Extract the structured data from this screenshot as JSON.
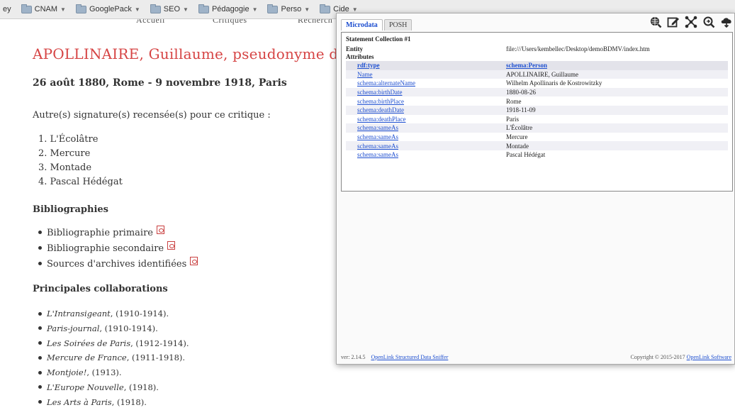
{
  "bookmarks": [
    {
      "label": "ey",
      "folder": false
    },
    {
      "label": "CNAM",
      "folder": true
    },
    {
      "label": "GooglePack",
      "folder": true
    },
    {
      "label": "SEO",
      "folder": true
    },
    {
      "label": "Pédagogie",
      "folder": true
    },
    {
      "label": "Perso",
      "folder": true
    },
    {
      "label": "Cide",
      "folder": true
    }
  ],
  "site_nav": {
    "home": "Accueil",
    "critics": "Critiques",
    "search": "Recherch"
  },
  "page": {
    "title": "APOLLINAIRE, Guillaume, pseudonyme de Wilhelm Apollinaris de Kostrowitzky",
    "dates": "26 août 1880, Rome - 9 novembre 1918, Paris",
    "signatures_intro": "Autre(s) signature(s) recensée(s) pour ce critique :",
    "signatures": [
      "L'Écolâtre",
      "Mercure",
      "Montade",
      "Pascal Hédégat"
    ],
    "bibliographies_heading": "Bibliographies",
    "bibliographies": [
      "Bibliographie primaire",
      "Bibliographie secondaire",
      "Sources d'archives identifiées"
    ],
    "collaborations_heading": "Principales collaborations",
    "collaborations": [
      {
        "name": "L'Intransigeant",
        "years": ", (1910-1914)."
      },
      {
        "name": "Paris-journal",
        "years": ", (1910-1914)."
      },
      {
        "name": "Les Soirées de Paris",
        "years": ", (1912-1914)."
      },
      {
        "name": "Mercure de France",
        "years": ", (1911-1918)."
      },
      {
        "name": "Montjoie!",
        "years": ", (1913)."
      },
      {
        "name": "L'Europe Nouvelle",
        "years": ", (1918)."
      },
      {
        "name": "Les Arts à Paris",
        "years": ", (1918)."
      }
    ]
  },
  "sniffer": {
    "tabs": [
      "Microdata",
      "POSH"
    ],
    "active_tab": "Microdata",
    "toolbar_icons": [
      "globe-search-icon",
      "edit-icon",
      "network-graph-icon",
      "search-share-icon",
      "cloud-download-icon"
    ],
    "collection_title": "Statement Collection #1",
    "entity_label": "Entity",
    "entity_value": "file:///Users/kembellec/Desktop/demoBDMV/index.htm",
    "attributes_label": "Attributes",
    "attributes": [
      {
        "key": "rdf:type",
        "value": "schema:Person",
        "value_link": true
      },
      {
        "key": "Name",
        "value": "APOLLINAIRE, Guillaume",
        "value_link": false
      },
      {
        "key": "schema:alternateName",
        "value": "Wilhelm Apollinaris de Kostrowitzky",
        "value_link": false
      },
      {
        "key": "schema:birthDate",
        "value": "1880-08-26",
        "value_link": false
      },
      {
        "key": "schema:birthPlace",
        "value": "Rome",
        "value_link": false
      },
      {
        "key": "schema:deathDate",
        "value": "1918-11-09",
        "value_link": false
      },
      {
        "key": "schema:deathPlace",
        "value": "Paris",
        "value_link": false
      },
      {
        "key": "schema:sameAs",
        "value": "L'Écolâtre",
        "value_link": false
      },
      {
        "key": "schema:sameAs",
        "value": "Mercure",
        "value_link": false
      },
      {
        "key": "schema:sameAs",
        "value": "Montade",
        "value_link": false
      },
      {
        "key": "schema:sameAs",
        "value": "Pascal Hédégat",
        "value_link": false
      }
    ],
    "version": "ver: 2.14.5",
    "footer_link": "OpenLink Structured Data Sniffer",
    "copyright": "Copyright © 2015-2017 ",
    "copyright_link": "OpenLink Software"
  },
  "colors": {
    "title_red": "#d64545",
    "link_blue": "#1e4fd0"
  }
}
